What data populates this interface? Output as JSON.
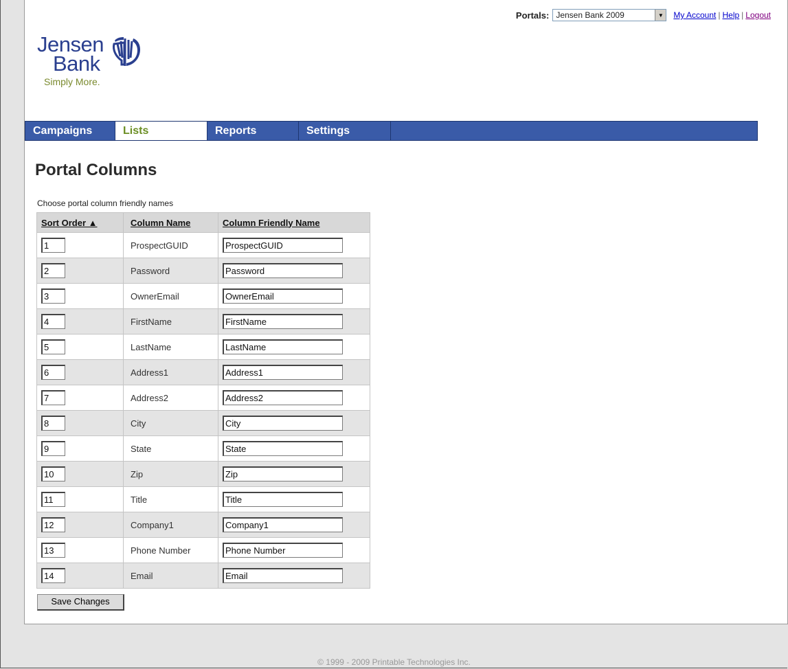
{
  "header": {
    "portals_label": "Portals:",
    "portal_selected": "Jensen Bank 2009",
    "links": [
      "My Account",
      "Help",
      "Logout"
    ]
  },
  "logo": {
    "line1": "Jensen",
    "line2": "Bank",
    "tagline": "Simply More."
  },
  "nav": {
    "tabs": [
      "Campaigns",
      "Lists",
      "Reports",
      "Settings"
    ],
    "active": "Lists"
  },
  "page": {
    "title": "Portal Columns",
    "subtitle": "Choose portal column friendly names"
  },
  "table": {
    "headers": [
      "Sort Order ▲",
      "Column Name",
      "Column Friendly Name"
    ],
    "rows": [
      {
        "order": "1",
        "name": "ProspectGUID",
        "friendly": "ProspectGUID"
      },
      {
        "order": "2",
        "name": "Password",
        "friendly": "Password"
      },
      {
        "order": "3",
        "name": "OwnerEmail",
        "friendly": "OwnerEmail"
      },
      {
        "order": "4",
        "name": "FirstName",
        "friendly": "FirstName"
      },
      {
        "order": "5",
        "name": "LastName",
        "friendly": "LastName"
      },
      {
        "order": "6",
        "name": "Address1",
        "friendly": "Address1"
      },
      {
        "order": "7",
        "name": "Address2",
        "friendly": "Address2"
      },
      {
        "order": "8",
        "name": "City",
        "friendly": "City"
      },
      {
        "order": "9",
        "name": "State",
        "friendly": "State"
      },
      {
        "order": "10",
        "name": "Zip",
        "friendly": "Zip"
      },
      {
        "order": "11",
        "name": "Title",
        "friendly": "Title"
      },
      {
        "order": "12",
        "name": "Company1",
        "friendly": "Company1"
      },
      {
        "order": "13",
        "name": "Phone Number",
        "friendly": "Phone Number"
      },
      {
        "order": "14",
        "name": "Email",
        "friendly": "Email"
      }
    ]
  },
  "save_label": "Save Changes",
  "footer": "© 1999 - 2009 Printable Technologies Inc.",
  "colors": {
    "nav_bg": "#3a5ba8",
    "active_tab_text": "#6b8e23",
    "logo_blue": "#2a3f8f",
    "tagline_green": "#7a8a2e"
  }
}
